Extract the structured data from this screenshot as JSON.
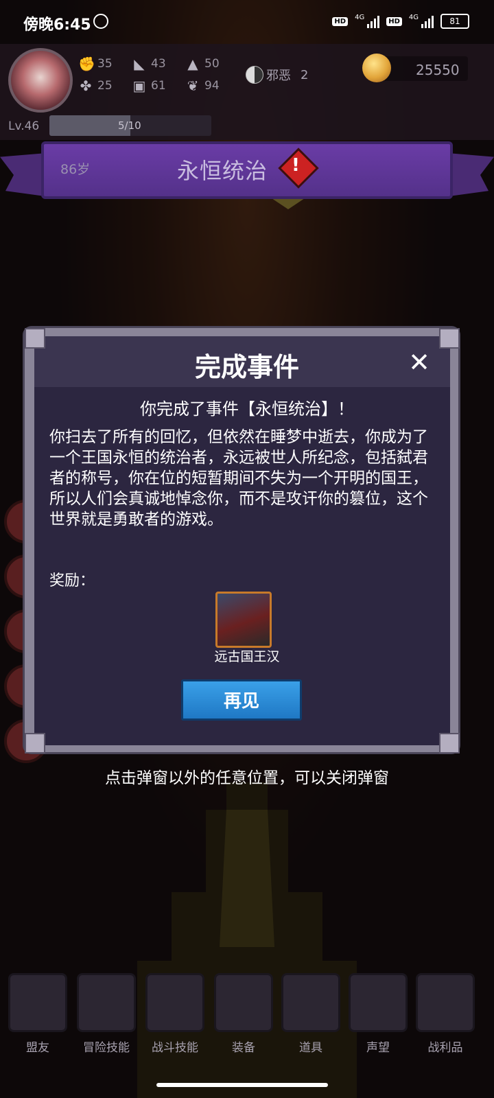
{
  "status_bar": {
    "time": "傍晚6:45",
    "hd1": "HD",
    "net1": "4G",
    "hd2": "HD",
    "net2": "4G",
    "battery": "81"
  },
  "hud": {
    "stats": [
      {
        "icon": "fist-icon",
        "value": "35"
      },
      {
        "icon": "boot-icon",
        "value": "43"
      },
      {
        "icon": "wizard-hat-icon",
        "value": "50"
      },
      {
        "icon": "clover-icon",
        "value": "25"
      },
      {
        "icon": "armor-icon",
        "value": "61"
      },
      {
        "icon": "leaf-icon",
        "value": "94"
      }
    ],
    "alignment_label": "邪恶",
    "alignment_value": "2",
    "gold": "25550",
    "level": "Lv.46",
    "xp_text": "5/10",
    "xp_fraction": 0.5
  },
  "event_banner": {
    "age": "86岁",
    "title": "永恒统治"
  },
  "modal": {
    "title": "完成事件",
    "close": "✕",
    "subtitle": "你完成了事件【永恒统治】！",
    "body": "你扫去了所有的回忆，但依然在睡梦中逝去，你成为了一个王国永恒的统治者，永远被世人所纪念，包括弑君者的称号，你在位的短暂期间不失为一个开明的国王，所以人们会真诚地悼念你，而不是攻讦你的篡位，这个世界就是勇敢者的游戏。",
    "reward_label": "奖励：",
    "reward_name": "远古国王汉",
    "button": "再见"
  },
  "hint": "点击弹窗以外的任意位置，可以关闭弹窗",
  "nav": [
    {
      "label": "盟友",
      "icon": "handshake-icon"
    },
    {
      "label": "冒险技能",
      "icon": "book-icon"
    },
    {
      "label": "战斗技能",
      "icon": "backpack-icon"
    },
    {
      "label": "装备",
      "icon": "swords-icon"
    },
    {
      "label": "道具",
      "icon": "bag-icon"
    },
    {
      "label": "声望",
      "icon": "scroll-icon"
    },
    {
      "label": "战利品",
      "icon": "chest-icon"
    }
  ]
}
